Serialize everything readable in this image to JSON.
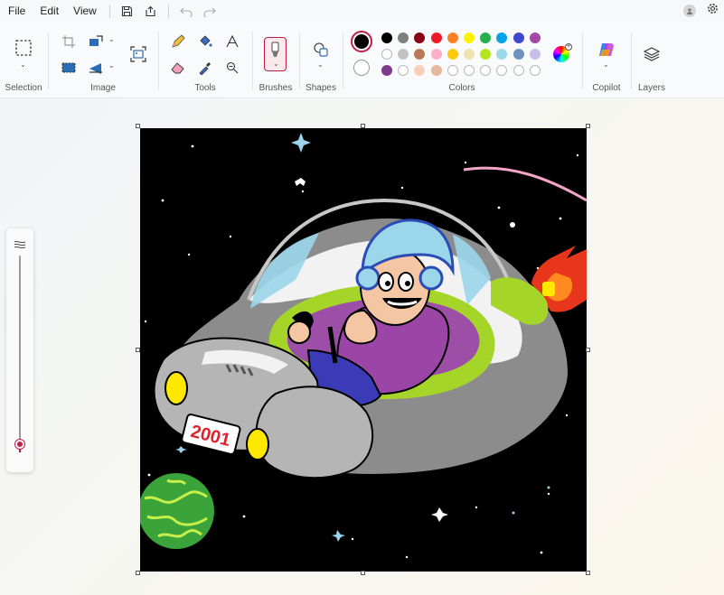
{
  "menu": {
    "file": "File",
    "edit": "Edit",
    "view": "View"
  },
  "ribbon": {
    "groups": {
      "selection": "Selection",
      "image": "Image",
      "tools": "Tools",
      "brushes": "Brushes",
      "shapes": "Shapes",
      "colors": "Colors",
      "copilot": "Copilot",
      "layers": "Layers"
    }
  },
  "colors": {
    "primary": "#000000",
    "secondary": "#ffffff",
    "accent": "#c21e46",
    "palette_row1": [
      "#000000",
      "#7f7f7f",
      "#880015",
      "#ed1c24",
      "#ff7f27",
      "#fff200",
      "#22b14c",
      "#00a2e8",
      "#3f48cc",
      "#a349a4"
    ],
    "palette_row2": [
      "#ffffff",
      "#c3c3c3",
      "#b97a57",
      "#ffaec9",
      "#ffc90e",
      "#efe4b0",
      "#b5e61d",
      "#99d9ea",
      "#7092be",
      "#c8bfe7"
    ],
    "palette_row3": [
      "#7e3a8e",
      "#ffffff",
      "#f8d0b8",
      "#e8b89a",
      "#ffffff",
      "#ffffff",
      "#ffffff",
      "#ffffff",
      "#ffffff",
      "#ffffff"
    ]
  },
  "icons": {
    "save": "save-icon",
    "share": "share-icon",
    "undo": "undo-icon",
    "redo": "redo-icon",
    "settings": "gear-icon",
    "account": "avatar-icon"
  },
  "canvas": {
    "plate_text": "2001"
  },
  "brush_size": {
    "level": 0.04
  }
}
